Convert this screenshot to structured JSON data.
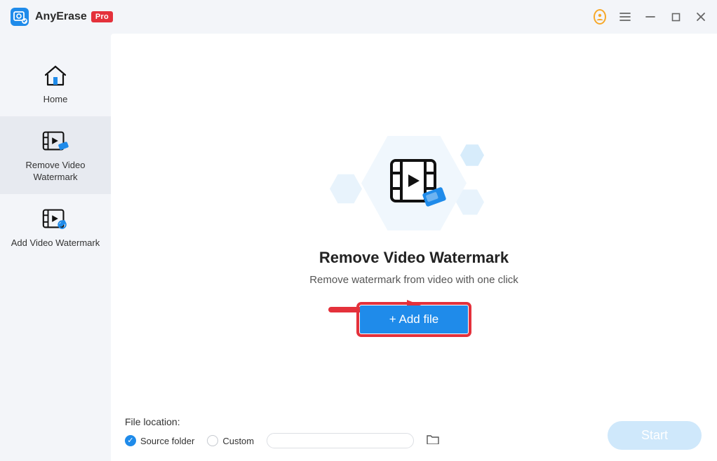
{
  "titlebar": {
    "app_name": "AnyErase",
    "pro_badge": "Pro"
  },
  "sidebar": {
    "items": [
      {
        "label": "Home"
      },
      {
        "label": "Remove Video Watermark"
      },
      {
        "label": "Add Video Watermark"
      }
    ]
  },
  "main": {
    "title": "Remove Video Watermark",
    "subtitle": "Remove watermark from video with one click",
    "add_file_label": "+ Add file"
  },
  "bottom": {
    "file_location_label": "File location:",
    "source_folder_label": "Source folder",
    "custom_label": "Custom",
    "start_label": "Start"
  }
}
